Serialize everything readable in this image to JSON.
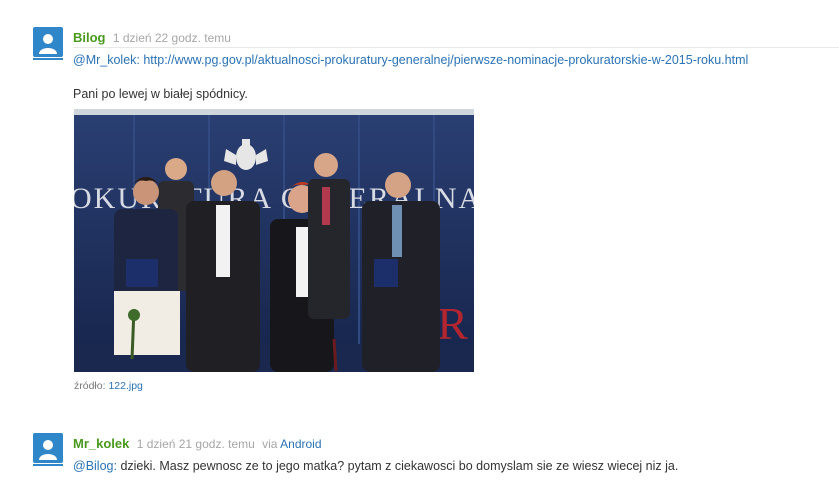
{
  "comments": [
    {
      "author": "Bilog",
      "time": "1 dzień 22 godz. temu",
      "mention": "@Mr_kolek:",
      "link": "http://www.pg.gov.pl/aktualnosci-prokuratury-generalnej/pierwsze-nominacje-prokuratorskie-w-2015-roku.html",
      "text": "Pani po lewej w białej spódnicy.",
      "image": {
        "wall_text": "OKURATURA GENERALNA",
        "wall_text_2": "UR",
        "source_label": "źródło:",
        "source_file": "122.jpg"
      }
    },
    {
      "author": "Mr_kolek",
      "time": "1 dzień 21 godz. temu",
      "via_label": "via",
      "via_client": "Android",
      "mention": "@Bilog:",
      "text": "dzieki. Masz pewnosc ze to jego matka? pytam z ciekawosci bo domyslam sie ze wiesz wiecej niz ja."
    }
  ],
  "colors": {
    "author": "#4a9a1e",
    "link": "#2b73b5",
    "avatar": "#2f86c8",
    "meta": "#a6a6a6"
  },
  "icons": {
    "avatar": "default-user-icon"
  }
}
